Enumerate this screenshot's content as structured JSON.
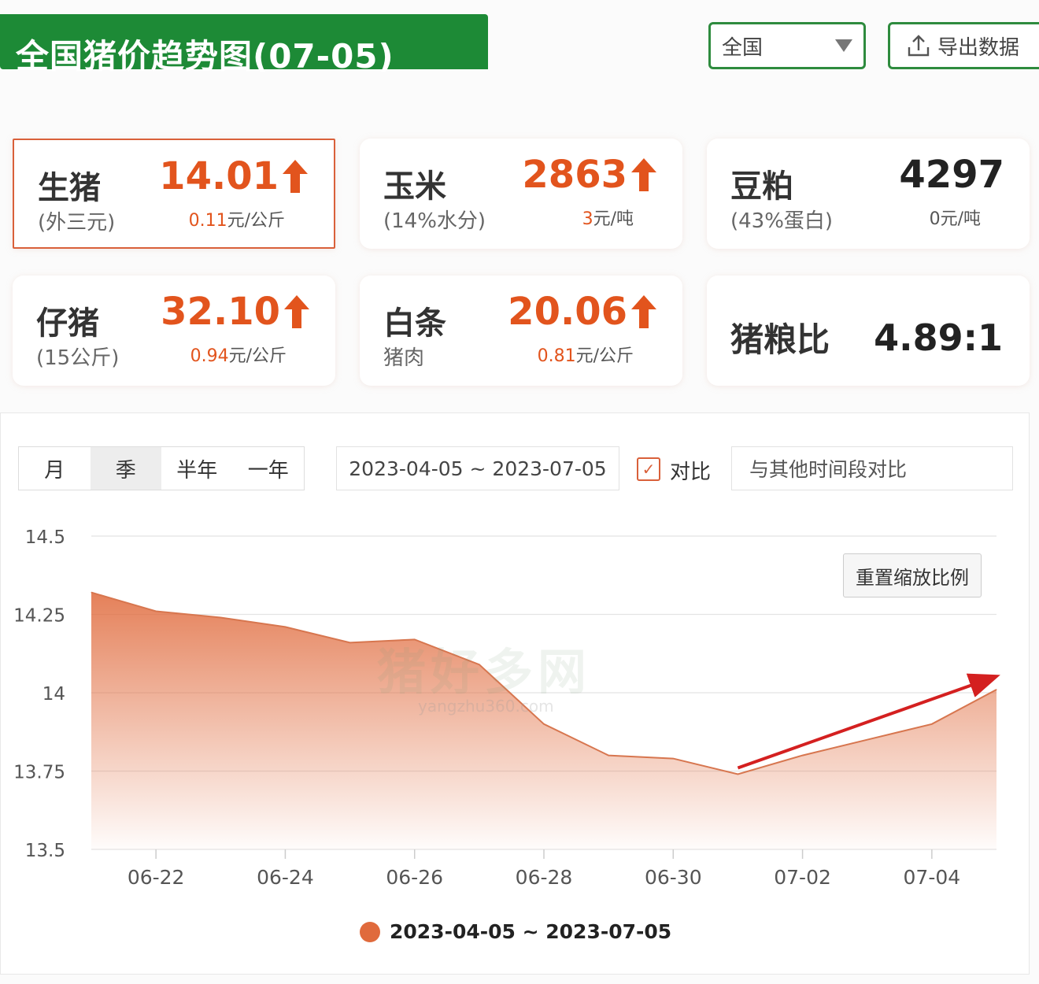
{
  "header": {
    "title": "全国猪价趋势图(07-05)",
    "region_select_value": "全国",
    "export_label": "导出数据"
  },
  "cards": [
    {
      "name": "生猪",
      "sub": "(外三元)",
      "price": "14.01",
      "delta_num": "0.11",
      "delta_unit": "元/公斤",
      "trend": "up",
      "selected": true
    },
    {
      "name": "玉米",
      "sub": "(14%水分)",
      "price": "2863",
      "delta_num": "3",
      "delta_unit": "元/吨",
      "trend": "up",
      "selected": false
    },
    {
      "name": "豆粕",
      "sub": "(43%蛋白)",
      "price": "4297",
      "delta_num": "0",
      "delta_unit": "元/吨",
      "trend": "flat",
      "selected": false
    },
    {
      "name": "仔猪",
      "sub": "(15公斤)",
      "price": "32.10",
      "delta_num": "0.94",
      "delta_unit": "元/公斤",
      "trend": "up",
      "selected": false
    },
    {
      "name": "白条",
      "sub": "猪肉",
      "price": "20.06",
      "delta_num": "0.81",
      "delta_unit": "元/公斤",
      "trend": "up",
      "selected": false
    },
    {
      "name": "猪粮比",
      "ratio": "4.89:1"
    }
  ],
  "controls": {
    "range_tabs": [
      "月",
      "季",
      "半年",
      "一年"
    ],
    "active_tab": "季",
    "date_range": "2023-04-05 ~ 2023-07-05",
    "compare_checked": true,
    "compare_label": "对比",
    "compare_placeholder": "与其他时间段对比",
    "reset_zoom_label": "重置缩放比例"
  },
  "watermark": {
    "main": "猪好多网",
    "sub": "yangzhu360.com"
  },
  "colors": {
    "brand_green": "#1d8a36",
    "accent_orange": "#e2541d",
    "series": "#e06a3c",
    "arrow": "#d42020"
  },
  "chart_data": {
    "type": "area",
    "x": [
      "06-21",
      "06-22",
      "06-23",
      "06-24",
      "06-25",
      "06-26",
      "06-27",
      "06-28",
      "06-29",
      "06-30",
      "07-01",
      "07-02",
      "07-03",
      "07-04",
      "07-05"
    ],
    "tick_labels": [
      "06-22",
      "06-24",
      "06-26",
      "06-28",
      "06-30",
      "07-02",
      "07-04"
    ],
    "yticks": [
      "14.5",
      "14.25",
      "14",
      "13.75",
      "13.5"
    ],
    "ylim": [
      13.5,
      14.5
    ],
    "series": [
      {
        "name": "2023-04-05 ~ 2023-07-05",
        "values": [
          14.32,
          14.26,
          14.24,
          14.21,
          14.16,
          14.17,
          14.09,
          13.9,
          13.8,
          13.79,
          13.74,
          13.8,
          13.85,
          13.9,
          14.01
        ]
      }
    ],
    "annotation": "red upward trend arrow from 07-01 toward 07-05",
    "grid": true
  }
}
